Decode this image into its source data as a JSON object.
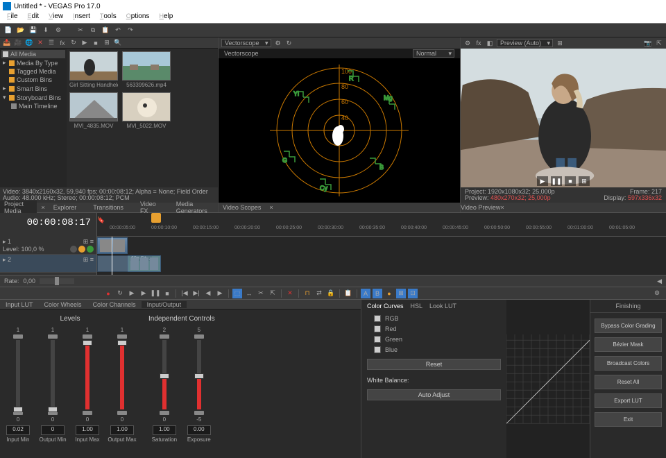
{
  "title": "Untitled * - VEGAS Pro 17.0",
  "menu": [
    "File",
    "Edit",
    "View",
    "Insert",
    "Tools",
    "Options",
    "Help"
  ],
  "tree": {
    "root": "All Media",
    "items": [
      "Media By Type",
      "Tagged Media",
      "Custom Bins",
      "Smart Bins",
      "Storyboard Bins",
      "Main Timeline"
    ]
  },
  "thumbs": [
    {
      "label": "Girl Sitting Handheld_MVI..."
    },
    {
      "label": "563399626.mp4"
    },
    {
      "label": "MVI_4835.MOV"
    },
    {
      "label": "MVI_5022.MOV"
    }
  ],
  "media_status": {
    "line1": "Video: 3840x2160x32, 59,940 fps; 00:00:08:12; Alpha = None; Field Order",
    "line2": "Audio: 48.000 kHz; Stereo; 00:00:08:12; PCM"
  },
  "lp_tabs": [
    "Project Media",
    "Explorer",
    "Transitions",
    "Video FX",
    "Media Generators"
  ],
  "scope": {
    "dd": "Vectorscope",
    "label": "Vectorscope",
    "mode": "Normal"
  },
  "mid_tabs": [
    "Video Scopes"
  ],
  "rp_dd": "Preview (Auto)",
  "preview_status": {
    "project": "Project:",
    "project_v": "1920x1080x32; 25,000p",
    "preview": "Preview:",
    "preview_v": "480x270x32; 25,000p",
    "frame": "Frame:",
    "frame_v": "217",
    "display": "Display:",
    "display_v": "597x336x32"
  },
  "rp_tabs": [
    "Video Preview"
  ],
  "timecode": "00:00:08:17",
  "ruler": [
    "00:00:05:00",
    "00:00:10:00",
    "00:00:15:00",
    "00:00:20:00",
    "00:00:25:00",
    "00:00:30:00",
    "00:00:35:00",
    "00:00:40:00",
    "00:00:45:00",
    "00:00:50:00",
    "00:00:55:00",
    "00:01:00:00",
    "00:01:05:00"
  ],
  "track_level": "Level: 100,0 %",
  "clip_label": "60p Sit...",
  "rate": {
    "label": "Rate:",
    "value": "0,00"
  },
  "cg_tabs": [
    "Input LUT",
    "Color Wheels",
    "Color Channels",
    "Input/Output"
  ],
  "levels": {
    "title": "Levels",
    "cols": [
      {
        "top": "1",
        "bot": "0",
        "input": "0.02",
        "label": "Input Min",
        "fill": 0,
        "handle": 96
      },
      {
        "top": "1",
        "bot": "0",
        "input": "0",
        "label": "Output Min",
        "fill": 0,
        "handle": 96
      },
      {
        "top": "1",
        "bot": "0",
        "input": "1.00",
        "label": "Input Max",
        "fill": 100,
        "handle": 0
      },
      {
        "top": "1",
        "bot": "0",
        "input": "1.00",
        "label": "Output Max",
        "fill": 100,
        "handle": 0
      }
    ]
  },
  "independent": {
    "title": "Independent Controls",
    "cols": [
      {
        "top": "2",
        "bot": "0",
        "input": "1.00",
        "label": "Saturation",
        "fill": 50,
        "handle": 48
      },
      {
        "top": "5",
        "bot": "-5",
        "input": "0.00",
        "label": "Exposure",
        "fill": 50,
        "handle": 48
      }
    ]
  },
  "curves": {
    "tabs": [
      "Color Curves",
      "HSL",
      "Look LUT"
    ],
    "checks": [
      "RGB",
      "Red",
      "Green",
      "Blue"
    ],
    "reset": "Reset",
    "wb": "White Balance:",
    "auto": "Auto Adjust"
  },
  "finishing": {
    "title": "Finishing",
    "btns": [
      "Bypass Color Grading",
      "Bézier Mask",
      "Broadcast Colors",
      "Reset All",
      "Export LUT",
      "Exit"
    ]
  }
}
